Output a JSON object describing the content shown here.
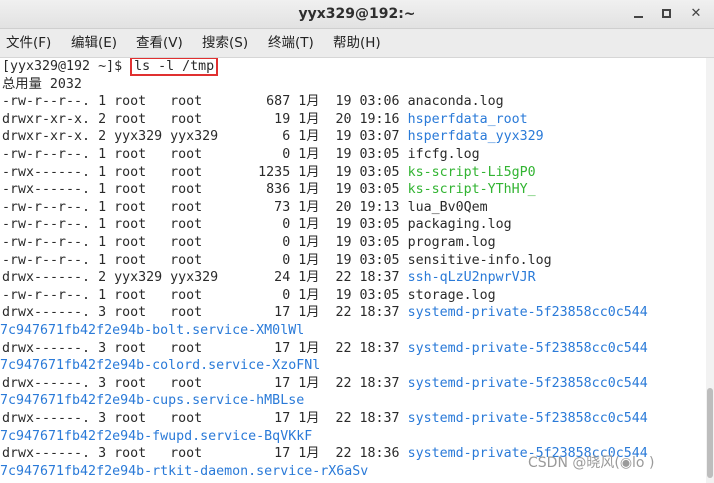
{
  "window": {
    "title": "yyx329@192:~"
  },
  "menu": [
    {
      "label": "文件(F)"
    },
    {
      "label": "编辑(E)"
    },
    {
      "label": "查看(V)"
    },
    {
      "label": "搜索(S)"
    },
    {
      "label": "终端(T)"
    },
    {
      "label": "帮助(H)"
    }
  ],
  "terminal": {
    "prompt": "[yyx329@192 ~]$ ",
    "command": "ls -l /tmp",
    "total": "总用量 2032",
    "entries": [
      {
        "perm": "-rw-r--r--.",
        "links": "1",
        "owner": "root",
        "group": "root",
        "size": "687",
        "month": "1月",
        "day": "19",
        "time": "03:06",
        "name": "anaconda.log",
        "color": "default"
      },
      {
        "perm": "drwxr-xr-x.",
        "links": "2",
        "owner": "root",
        "group": "root",
        "size": "19",
        "month": "1月",
        "day": "20",
        "time": "19:16",
        "name": "hsperfdata_root",
        "color": "blue"
      },
      {
        "perm": "drwxr-xr-x.",
        "links": "2",
        "owner": "yyx329",
        "group": "yyx329",
        "size": "6",
        "month": "1月",
        "day": "19",
        "time": "03:07",
        "name": "hsperfdata_yyx329",
        "color": "blue"
      },
      {
        "perm": "-rw-r--r--.",
        "links": "1",
        "owner": "root",
        "group": "root",
        "size": "0",
        "month": "1月",
        "day": "19",
        "time": "03:05",
        "name": "ifcfg.log",
        "color": "default"
      },
      {
        "perm": "-rwx------.",
        "links": "1",
        "owner": "root",
        "group": "root",
        "size": "1235",
        "month": "1月",
        "day": "19",
        "time": "03:05",
        "name": "ks-script-Li5gP0",
        "color": "green"
      },
      {
        "perm": "-rwx------.",
        "links": "1",
        "owner": "root",
        "group": "root",
        "size": "836",
        "month": "1月",
        "day": "19",
        "time": "03:05",
        "name": "ks-script-YThHY_",
        "color": "green"
      },
      {
        "perm": "-rw-r--r--.",
        "links": "1",
        "owner": "root",
        "group": "root",
        "size": "73",
        "month": "1月",
        "day": "20",
        "time": "19:13",
        "name": "lua_Bv0Qem",
        "color": "default"
      },
      {
        "perm": "-rw-r--r--.",
        "links": "1",
        "owner": "root",
        "group": "root",
        "size": "0",
        "month": "1月",
        "day": "19",
        "time": "03:05",
        "name": "packaging.log",
        "color": "default"
      },
      {
        "perm": "-rw-r--r--.",
        "links": "1",
        "owner": "root",
        "group": "root",
        "size": "0",
        "month": "1月",
        "day": "19",
        "time": "03:05",
        "name": "program.log",
        "color": "default"
      },
      {
        "perm": "-rw-r--r--.",
        "links": "1",
        "owner": "root",
        "group": "root",
        "size": "0",
        "month": "1月",
        "day": "19",
        "time": "03:05",
        "name": "sensitive-info.log",
        "color": "default"
      },
      {
        "perm": "drwx------.",
        "links": "2",
        "owner": "yyx329",
        "group": "yyx329",
        "size": "24",
        "month": "1月",
        "day": "22",
        "time": "18:37",
        "name": "ssh-qLzU2npwrVJR",
        "color": "blue"
      },
      {
        "perm": "-rw-r--r--.",
        "links": "1",
        "owner": "root",
        "group": "root",
        "size": "0",
        "month": "1月",
        "day": "19",
        "time": "03:05",
        "name": "storage.log",
        "color": "default"
      },
      {
        "perm": "drwx------.",
        "links": "3",
        "owner": "root",
        "group": "root",
        "size": "17",
        "month": "1月",
        "day": "22",
        "time": "18:37",
        "name": "systemd-private-5f23858cc0c544",
        "cont": "7c947671fb42f2e94b-bolt.service-XM0lWl",
        "color": "blue"
      },
      {
        "perm": "drwx------.",
        "links": "3",
        "owner": "root",
        "group": "root",
        "size": "17",
        "month": "1月",
        "day": "22",
        "time": "18:37",
        "name": "systemd-private-5f23858cc0c544",
        "cont": "7c947671fb42f2e94b-colord.service-XzoFNl",
        "color": "blue"
      },
      {
        "perm": "drwx------.",
        "links": "3",
        "owner": "root",
        "group": "root",
        "size": "17",
        "month": "1月",
        "day": "22",
        "time": "18:37",
        "name": "systemd-private-5f23858cc0c544",
        "cont": "7c947671fb42f2e94b-cups.service-hMBLse",
        "color": "blue"
      },
      {
        "perm": "drwx------.",
        "links": "3",
        "owner": "root",
        "group": "root",
        "size": "17",
        "month": "1月",
        "day": "22",
        "time": "18:37",
        "name": "systemd-private-5f23858cc0c544",
        "cont": "7c947671fb42f2e94b-fwupd.service-BqVKkF",
        "color": "blue"
      },
      {
        "perm": "drwx------.",
        "links": "3",
        "owner": "root",
        "group": "root",
        "size": "17",
        "month": "1月",
        "day": "22",
        "time": "18:36",
        "name": "systemd-private-5f23858cc0c544",
        "cont": "7c947671fb42f2e94b-rtkit-daemon.service-rX6aSv",
        "color": "blue"
      }
    ]
  },
  "watermark": "CSDN @晓风(◉lo )"
}
